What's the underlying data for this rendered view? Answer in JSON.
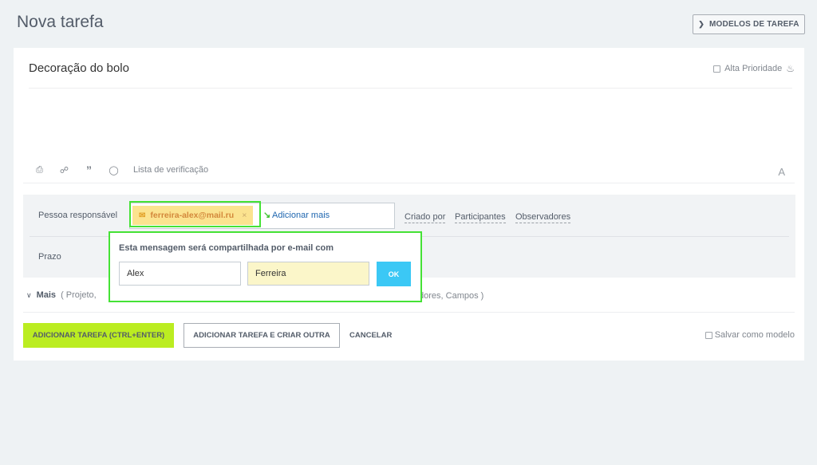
{
  "header": {
    "title": "Nova tarefa",
    "templates_button": "MODELOS DE TAREFA"
  },
  "task": {
    "title": "Decoração do bolo",
    "high_priority_label": "Alta Prioridade"
  },
  "toolbar": {
    "checklist_label": "Lista de verificação",
    "font_label": "A"
  },
  "fields": {
    "responsible_label": "Pessoa responsável",
    "responsible_chip": "ferreira-alex@mail.ru",
    "chip_remove": "×",
    "add_more": "Adicionar mais",
    "created_by": "Criado por",
    "participants": "Participantes",
    "observers": "Observadores",
    "deadline_label": "Prazo"
  },
  "popup": {
    "title": "Esta mensagem será compartilhada por e-mail com",
    "first_name": "Alex",
    "last_name": "Ferreira",
    "ok_label": "OK"
  },
  "more": {
    "label": "Mais",
    "visible_start": "( Projeto,",
    "visible_end": "dores,  Campos )"
  },
  "actions": {
    "add_task": "ADICIONAR TAREFA (CTRL+ENTER)",
    "add_and_create": "ADICIONAR TAREFA E CRIAR OUTRA",
    "cancel": "CANCELAR",
    "save_as_template": "Salvar como modelo"
  },
  "colors": {
    "accent_green": "#bbed21",
    "ok_blue": "#3bc8f5",
    "highlight": "#45e235",
    "chip_bg": "#fbe38f"
  }
}
